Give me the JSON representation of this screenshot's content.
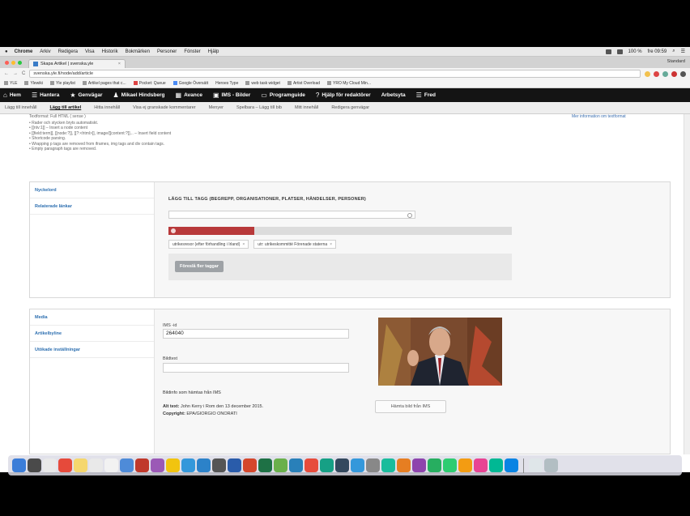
{
  "macbar": {
    "apple": "",
    "menus": [
      "Chrome",
      "Arkiv",
      "Redigera",
      "Visa",
      "Historik",
      "Bokmärken",
      "Personer",
      "Fönster",
      "Hjälp"
    ],
    "clock": "fre 09:59",
    "battery": "100 %"
  },
  "browser": {
    "tab_title": "Skapa Artikel | svenska.yle",
    "tab_close": "×",
    "user": "Standard",
    "url": "svenska.yle.fi/node/add/article",
    "bookmarks": [
      "YLE",
      "Ylewiki",
      "Yle playlist",
      "Artikel pages that c...",
      "Pocket: Queue",
      "Google Översätt",
      "Heroes Type",
      "web task widget",
      "Artist Overload",
      "YRO My Cloud Min..."
    ]
  },
  "adminbar": {
    "items": [
      {
        "icon": "⌂",
        "label": "Hem"
      },
      {
        "icon": "☰",
        "label": "Hantera"
      },
      {
        "icon": "★",
        "label": "Genvägar"
      },
      {
        "icon": "♟",
        "label": "Mikael Hindsberg"
      },
      {
        "icon": "▦",
        "label": "Avance"
      },
      {
        "icon": "▣",
        "label": "IMS - Bilder"
      },
      {
        "icon": "▭",
        "label": "Programguide"
      },
      {
        "icon": "?",
        "label": "Hjälp för redaktörer"
      },
      {
        "icon": "",
        "label": "Arbetsyta"
      },
      {
        "icon": "☰",
        "label": "Fred"
      }
    ]
  },
  "subtabs": [
    "Lägg till innehåll",
    "Lägg till artikel",
    "Hitta innehåll",
    "Visa ej granskade kommentarer",
    "Menyer",
    "Spelbara – Lägg till bib",
    "Mitt innehåll",
    "Redigera genvägar"
  ],
  "textformat": {
    "heading": "Textformat: Full HTML ( sense )",
    "more_link": "Mer information om textformat",
    "rules": [
      "Rader och stycken bryts automatiskt.",
      "[[ntv:1]] – Insert a node content",
      "[[field:term]], [[node:?]], [[?:<html>]], image/[[content:?]]... – Insert field content",
      "Shortcode parsing.",
      "Wrapping p tags are removed from iframes, img tags and div contain tags.",
      "Empty paragraph tags are removed."
    ]
  },
  "tags_panel": {
    "side_items": [
      "Nyckelord",
      "Relaterade länkar"
    ],
    "title": "LÄGG TILL TAGG (BEGREPP, ORGANISATIONER, PLATSER, HÄNDELSER, PERSONER)",
    "progress_fraction": 0.25,
    "chips": [
      "utrikesresor (efter förhandling i Irland)",
      "utr: utrikeskommitté Förenade staterna"
    ],
    "chip_remove": "×",
    "save_button": "Föreslå fler taggar"
  },
  "media_panel": {
    "side_items": [
      "Media",
      "Artikelbyline",
      "Utökade inställningar"
    ],
    "ims_label": "IMS -id",
    "ims_value": "264040",
    "caption_label": "Bildtext",
    "caption_value": "",
    "info_label": "Bildinfo som hämtas från IMS",
    "alt_label": "Alt text:",
    "alt_value": "John Kerry i Rom den 13 december 2015.",
    "copyright_label": "Copyright:",
    "copyright_value": "EPA/GIORGIO ONORATI",
    "fetch_button": "Hämta bild från IMS"
  },
  "colors": {
    "admin_bar": "#141414",
    "link": "#2d6fb0",
    "progress_fill": "#b8393a"
  }
}
